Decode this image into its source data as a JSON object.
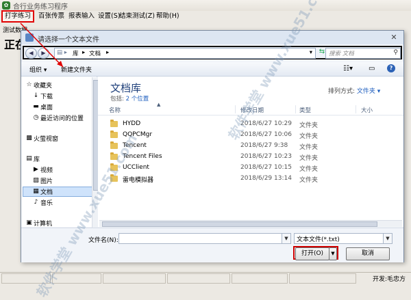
{
  "app": {
    "title": "合行业务练习程序",
    "menu": [
      "打字练习",
      "百张传票",
      "报表输入",
      "设置(S)",
      "结束测试(Z)",
      "帮助(H)"
    ],
    "side_label": "测试数据",
    "side_big": "正在",
    "status_developer": "开发:毛忠方"
  },
  "dialog": {
    "title": "请选择一个文本文件",
    "close_glyph": "✕",
    "address": {
      "root": "库",
      "current": "文档"
    },
    "search_placeholder": "搜索 文档",
    "toolbar": {
      "organize": "组织 ▾",
      "new_folder": "新建文件夹"
    },
    "nav_items": [
      {
        "icon": "☆",
        "label": "收藏夹",
        "group": true
      },
      {
        "icon": "↓",
        "label": "下载"
      },
      {
        "icon": "▬",
        "label": "桌面"
      },
      {
        "icon": "◷",
        "label": "最近访问的位置"
      },
      {
        "icon": "▩",
        "label": "火萤视窗",
        "group": true
      },
      {
        "icon": "▤",
        "label": "库",
        "group": true
      },
      {
        "icon": "▶",
        "label": "视频"
      },
      {
        "icon": "▨",
        "label": "图片"
      },
      {
        "icon": "▦",
        "label": "文档",
        "selected": true
      },
      {
        "icon": "♪",
        "label": "音乐"
      },
      {
        "icon": "▣",
        "label": "计算机",
        "group": true
      }
    ],
    "library": {
      "title": "文档库",
      "includes_prefix": "包括:",
      "includes_link": "2 个位置",
      "arrange_label": "排列方式:",
      "arrange_value": "文件夹 ▾"
    },
    "columns": [
      "名称",
      "修改日期",
      "类型",
      "大小"
    ],
    "files": [
      {
        "name": "HYDD",
        "date": "2018/6/27 10:29",
        "type": "文件夹"
      },
      {
        "name": "QQPCMgr",
        "date": "2018/6/27 10:06",
        "type": "文件夹"
      },
      {
        "name": "Tencent",
        "date": "2018/6/27 9:38",
        "type": "文件夹"
      },
      {
        "name": "Tencent Files",
        "date": "2018/6/27 10:23",
        "type": "文件夹"
      },
      {
        "name": "UCClient",
        "date": "2018/6/27 10:15",
        "type": "文件夹"
      },
      {
        "name": "雷电模拟器",
        "date": "2018/6/29 13:14",
        "type": "文件夹"
      }
    ],
    "filename_label": "文件名(N):",
    "filename_value": "",
    "filter_value": "文本文件(*.txt)",
    "open_label": "打开(O)",
    "cancel_label": "取消"
  },
  "watermark": "软件学堂 www.xue51.com"
}
